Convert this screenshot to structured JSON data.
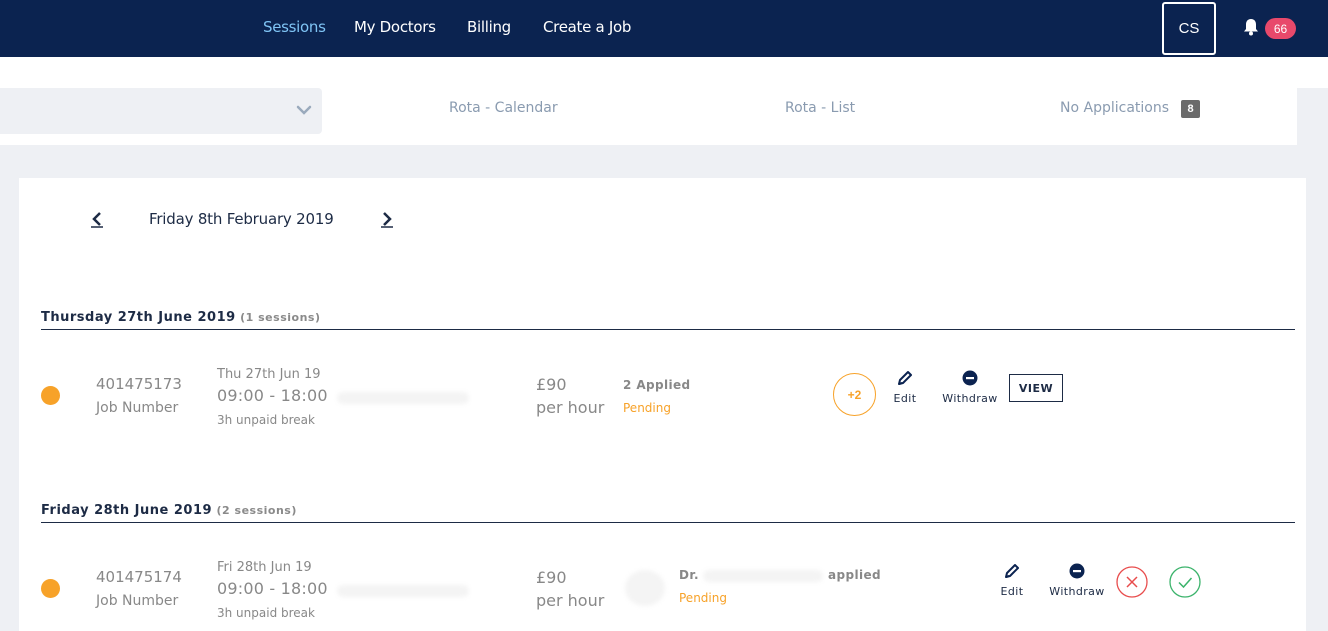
{
  "nav": {
    "items": [
      {
        "label": "Sessions",
        "active": true
      },
      {
        "label": "My Doctors",
        "active": false
      },
      {
        "label": "Billing",
        "active": false
      },
      {
        "label": "Create a Job",
        "active": false
      }
    ],
    "avatar_initials": "CS",
    "notification_icon": "bell-icon",
    "notification_count": "66"
  },
  "tabs": {
    "rota_calendar": "Rota - Calendar",
    "rota_list": "Rota - List",
    "no_applications": "No Applications",
    "no_applications_count": "8"
  },
  "date_nav": {
    "current_date": "Friday 8th February 2019"
  },
  "days": [
    {
      "title": "Thursday 27th June 2019",
      "count": "(1 sessions)",
      "sessions": [
        {
          "job_number": "401475173",
          "job_number_label": "Job Number",
          "date": "Thu 27th Jun 19",
          "time": "09:00 - 18:00",
          "break": "3h unpaid break",
          "rate_amount": "£90",
          "rate_unit": "per hour",
          "applied": "2 Applied",
          "status": "Pending",
          "extra_applicants": "+2",
          "edit_label": "Edit",
          "withdraw_label": "Withdraw",
          "view_label": "VIEW"
        }
      ]
    },
    {
      "title": "Friday 28th June 2019",
      "count": "(2 sessions)",
      "sessions": [
        {
          "job_number": "401475174",
          "job_number_label": "Job Number",
          "date": "Fri 28th Jun 19",
          "time": "09:00 - 18:00",
          "break": "3h unpaid break",
          "rate_amount": "£90",
          "rate_unit": "per hour",
          "doctor_prefix": "Dr.",
          "applied": "applied",
          "status": "Pending",
          "edit_label": "Edit",
          "withdraw_label": "Withdraw"
        }
      ]
    }
  ],
  "colors": {
    "nav_bg": "#0b2350",
    "nav_active": "#7fc4f5",
    "pending": "#f7a229",
    "badge": "#e8496b",
    "reject": "#e84c4c",
    "accept": "#3bb36b"
  }
}
